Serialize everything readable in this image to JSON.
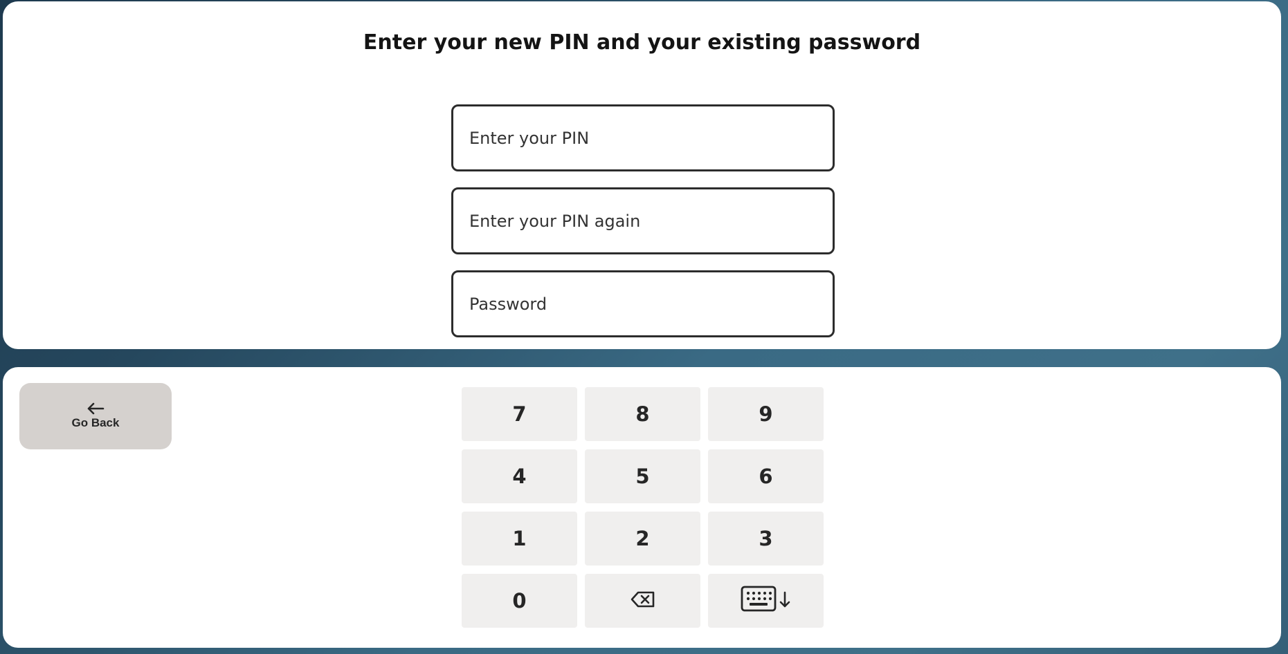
{
  "title": "Enter your new PIN and your existing password",
  "fields": {
    "pin_placeholder": "Enter your PIN",
    "pin_again_placeholder": "Enter your PIN again",
    "password_placeholder": "Password"
  },
  "nav": {
    "go_back_label": "Go Back",
    "go_back_icon": "arrow-left-icon"
  },
  "keypad": {
    "keys": [
      "7",
      "8",
      "9",
      "4",
      "5",
      "6",
      "1",
      "2",
      "3",
      "0"
    ],
    "backspace_icon": "backspace-icon",
    "hide_keyboard_icon": "keyboard-hide-icon"
  },
  "colors": {
    "panel": "#ffffff",
    "field_border": "#2c2c2c",
    "key_bg": "#f0efee",
    "back_button_bg": "#d5d1ce",
    "background_dark": "#1e3a4f",
    "background_light": "#3f7089"
  }
}
